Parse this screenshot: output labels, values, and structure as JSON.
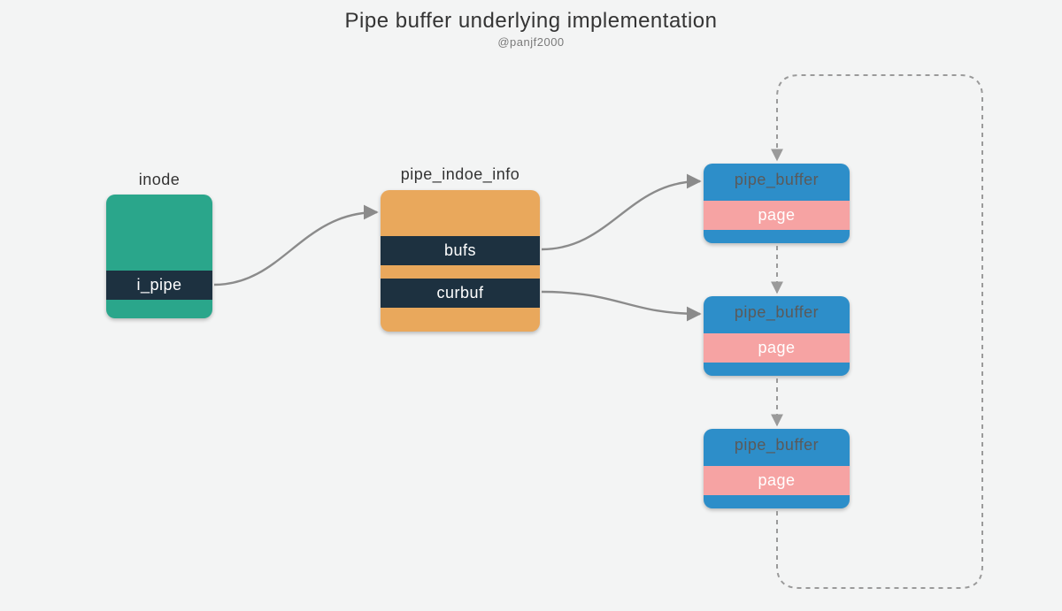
{
  "title": "Pipe buffer underlying implementation",
  "subtitle": "@panjf2000",
  "nodes": {
    "inode": {
      "label": "inode",
      "fields": {
        "i_pipe": "i_pipe"
      }
    },
    "pipe_inode_info": {
      "label": "pipe_indoe_info",
      "fields": {
        "bufs": "bufs",
        "curbuf": "curbuf"
      }
    },
    "pipe_buffer_1": {
      "label": "pipe_buffer",
      "fields": {
        "page": "page"
      }
    },
    "pipe_buffer_2": {
      "label": "pipe_buffer",
      "fields": {
        "page": "page"
      }
    },
    "pipe_buffer_3": {
      "label": "pipe_buffer",
      "fields": {
        "page": "page"
      }
    }
  },
  "colors": {
    "inode": "#2aa68b",
    "pipe_inode_info": "#e9a85c",
    "pipe_buffer": "#2d8ec9",
    "field_bg": "#1d3140",
    "page_bg": "#f6a3a3",
    "arrow": "#8b8b8b",
    "dash": "#9a9a9a",
    "bg": "#f3f4f4"
  }
}
